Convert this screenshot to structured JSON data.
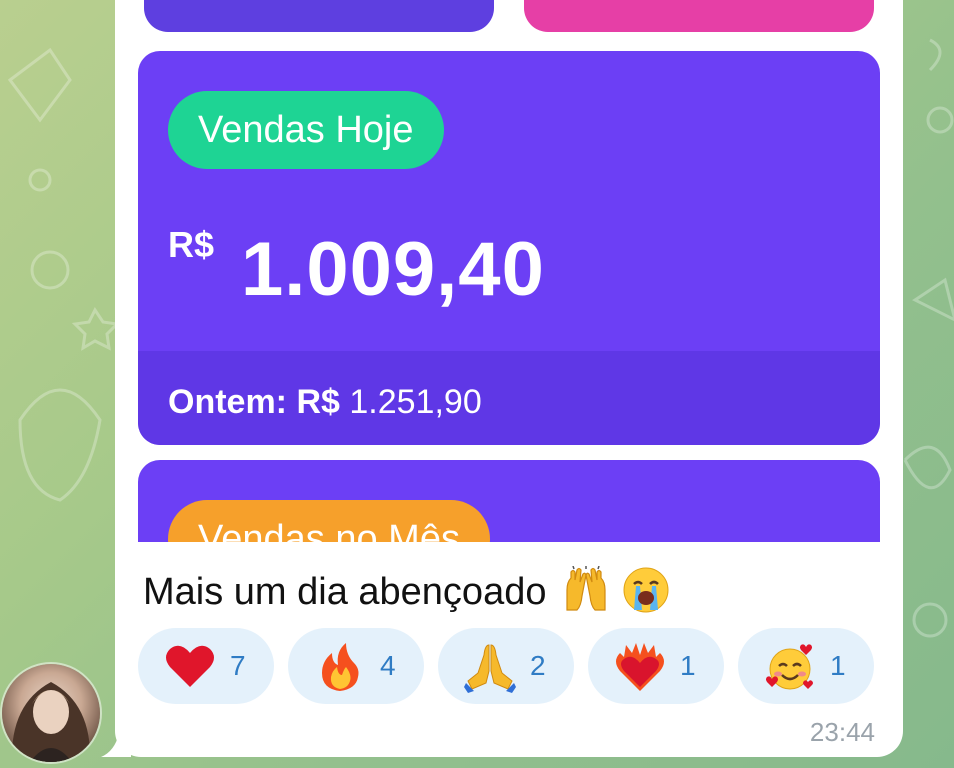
{
  "card": {
    "title": "Vendas Hoje",
    "currency": "R$",
    "amount": "1.009,40",
    "yesterday_label": "Ontem: R$",
    "yesterday_value": "1.251,90",
    "next_title": "Vendas no Mês"
  },
  "message": {
    "text": "Mais um dia abençoado",
    "emojis": [
      "raising-hands",
      "loudly-crying-face"
    ],
    "time": "23:44"
  },
  "reactions": [
    {
      "emoji": "red-heart",
      "count": "7"
    },
    {
      "emoji": "fire",
      "count": "4"
    },
    {
      "emoji": "folded-hands",
      "count": "2"
    },
    {
      "emoji": "heart-on-fire",
      "count": "1"
    },
    {
      "emoji": "smiling-face-with-hearts",
      "count": "1"
    }
  ],
  "colors": {
    "card_purple": "#6c3ff5",
    "badge_green": "#1ed494",
    "badge_orange": "#f6a02b",
    "reaction_bg": "#e4f1fb",
    "reaction_count": "#2f7cc4"
  }
}
